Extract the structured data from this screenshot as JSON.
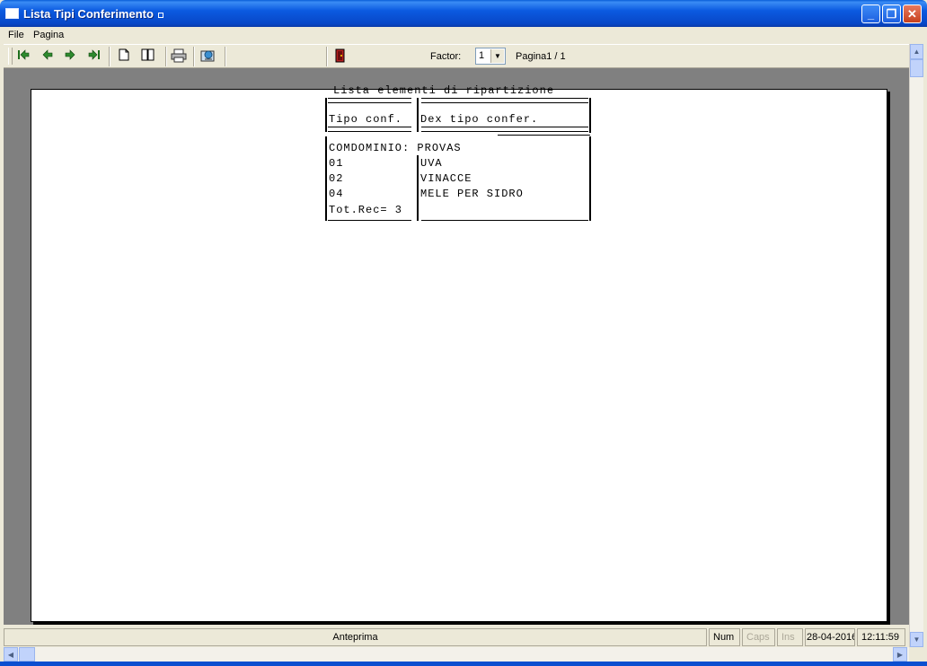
{
  "window": {
    "title": "Lista Tipi Conferimento",
    "minimize_symbol": "_",
    "restore_symbol": "❐",
    "close_symbol": "✕"
  },
  "menu": [
    {
      "label": "File"
    },
    {
      "label": "Pagina"
    }
  ],
  "toolbar": {
    "icons": [
      "first-page-icon",
      "previous-page-icon",
      "next-page-icon",
      "last-page-icon",
      "single-page-icon",
      "two-pages-icon",
      "print-icon",
      "export-icon",
      "exit-door-icon"
    ],
    "factor_label": "Factor:",
    "factor_value": "1",
    "page_indicator": "Pagina1 / 1"
  },
  "report": {
    "title": "Lista elementi di ripartizione",
    "columns": [
      "Tipo conf.",
      "Dex tipo confer."
    ],
    "group_label": "COMDOMINIO: PROVAS",
    "rows": [
      {
        "code": "01",
        "description": "UVA"
      },
      {
        "code": "02",
        "description": "VINACCE"
      },
      {
        "code": "04",
        "description": "MELE PER SIDRO"
      }
    ],
    "total": "Tot.Rec= 3"
  },
  "status": {
    "mode": "Anteprima",
    "num": "Num",
    "caps": "Caps",
    "ins": "Ins",
    "date": "28-04-2016",
    "time": "12:11:59"
  },
  "colors": {
    "title_bar": "#0b5ae0",
    "preview_background": "#808080",
    "paper": "#ffffff",
    "chrome": "#ece9d8"
  }
}
